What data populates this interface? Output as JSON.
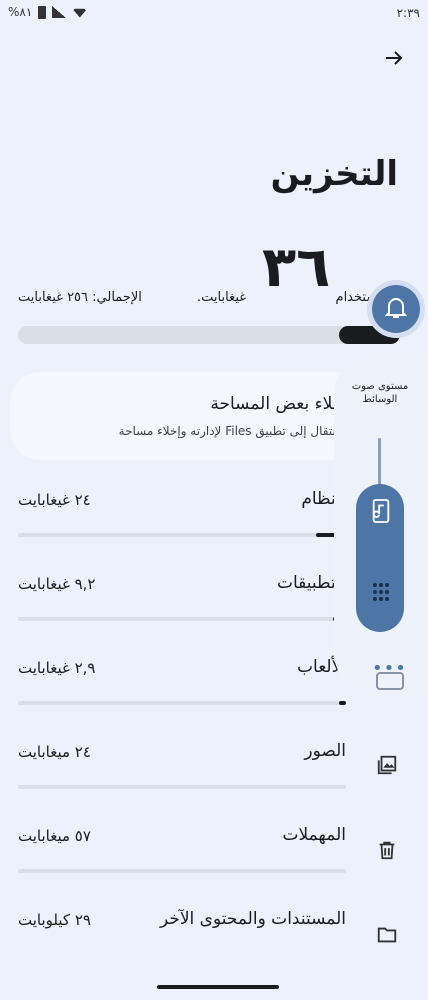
{
  "status": {
    "time": "٢:٣٩",
    "battery": "%٨١"
  },
  "page": {
    "title": "التخزين"
  },
  "usage": {
    "used_number": "٣٦",
    "used_label": "المستخدام",
    "used_unit": "غيغابايت.",
    "total_label": "الإجمالي: ٢٥٦ غيغابايت",
    "used_fraction": 0.16
  },
  "free_card": {
    "title": "إخلاء بعض المساحة",
    "subtitle": "الانتقال إلى تطبيق Files لإدارته وإخلاء مساحة"
  },
  "categories": [
    {
      "label": "النظام",
      "value": "٢٤ غيغابايت",
      "fraction": 0.09
    },
    {
      "label": "التطبيقات",
      "value": "٩,٢ غيغابايت",
      "fraction": 0.04
    },
    {
      "label": "الألعاب",
      "value": "٢,٩ غيغابايت",
      "fraction": 0.02
    },
    {
      "label": "الصور",
      "value": "٢٤ ميغابايت",
      "fraction": 0
    },
    {
      "label": "المهملات",
      "value": "٥٧ ميغابايت",
      "fraction": 0
    },
    {
      "label": "المستندات والمحتوى الآخر",
      "value": "٢٩ كيلوبايت",
      "fraction": 0
    }
  ],
  "volume": {
    "title": "مستوى صوت الوسائط",
    "level": 0.7
  }
}
